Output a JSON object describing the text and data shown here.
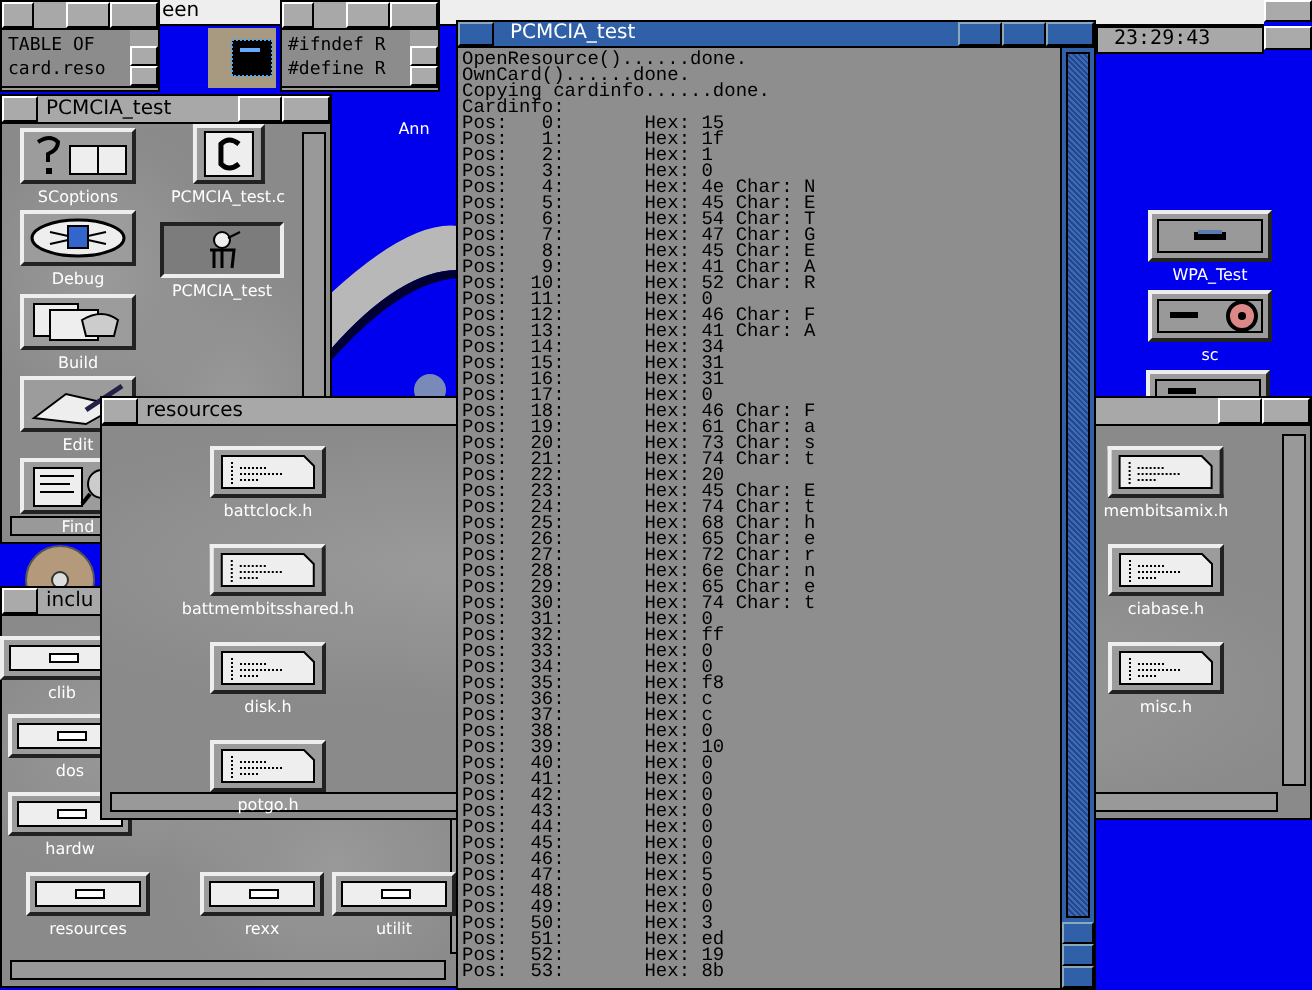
{
  "screen_bar": {
    "title": "een"
  },
  "clock": {
    "time": "23:29:43"
  },
  "text_windows": [
    {
      "lines": [
        "TABLE OF",
        "card.reso"
      ]
    },
    {
      "lines": [
        "#ifndef R",
        "#define R"
      ]
    }
  ],
  "desktop_icons": [
    {
      "label": "Ann",
      "kind": "covered"
    },
    {
      "label": "WPA_Test",
      "kind": "drawer"
    },
    {
      "label": "sc",
      "kind": "disk"
    }
  ],
  "drawers": [
    {
      "title": "PCMCIA_test",
      "icons": [
        {
          "label": "SCoptions",
          "kind": "options",
          "selected": false
        },
        {
          "label": "PCMCIA_test.c",
          "kind": "csource",
          "selected": false
        },
        {
          "label": "Debug",
          "kind": "debug",
          "selected": false
        },
        {
          "label": "PCMCIA_test",
          "kind": "program",
          "selected": true
        },
        {
          "label": "Build",
          "kind": "build",
          "selected": false
        },
        {
          "label": "Edit",
          "kind": "edit",
          "selected": false
        },
        {
          "label": "Find",
          "kind": "find",
          "selected": false
        }
      ]
    },
    {
      "title": "inclu",
      "icons": [
        {
          "label": "clib",
          "kind": "drawer",
          "selected": false
        },
        {
          "label": "dos",
          "kind": "drawer",
          "selected": false
        },
        {
          "label": "hardw",
          "kind": "drawer",
          "selected": false
        },
        {
          "label": "resources",
          "kind": "drawer",
          "selected": false
        },
        {
          "label": "rexx",
          "kind": "drawer",
          "selected": false
        },
        {
          "label": "utilit",
          "kind": "drawer",
          "selected": false
        }
      ]
    },
    {
      "title": "resources",
      "icons": [
        {
          "label": "battclock.h",
          "kind": "header",
          "selected": false
        },
        {
          "label": "battmembitsshared.h",
          "kind": "header",
          "selected": false
        },
        {
          "label": "disk.h",
          "kind": "header",
          "selected": false
        },
        {
          "label": "potgo.h",
          "kind": "header",
          "selected": false
        },
        {
          "label": "membitsamix.h",
          "kind": "header",
          "selected": false
        },
        {
          "label": "ciabase.h",
          "kind": "header",
          "selected": false
        },
        {
          "label": "misc.h",
          "kind": "header",
          "selected": false
        }
      ]
    }
  ],
  "console": {
    "title": "PCMCIA_test",
    "lines": [
      "OpenResource()......done.",
      "OwnCard()......done.",
      "Copying cardinfo......done.",
      "Cardinfo:",
      "Pos:   0:       Hex: 15",
      "Pos:   1:       Hex: 1f",
      "Pos:   2:       Hex: 1",
      "Pos:   3:       Hex: 0",
      "Pos:   4:       Hex: 4e Char: N",
      "Pos:   5:       Hex: 45 Char: E",
      "Pos:   6:       Hex: 54 Char: T",
      "Pos:   7:       Hex: 47 Char: G",
      "Pos:   8:       Hex: 45 Char: E",
      "Pos:   9:       Hex: 41 Char: A",
      "Pos:  10:       Hex: 52 Char: R",
      "Pos:  11:       Hex: 0",
      "Pos:  12:       Hex: 46 Char: F",
      "Pos:  13:       Hex: 41 Char: A",
      "Pos:  14:       Hex: 34",
      "Pos:  15:       Hex: 31",
      "Pos:  16:       Hex: 31",
      "Pos:  17:       Hex: 0",
      "Pos:  18:       Hex: 46 Char: F",
      "Pos:  19:       Hex: 61 Char: a",
      "Pos:  20:       Hex: 73 Char: s",
      "Pos:  21:       Hex: 74 Char: t",
      "Pos:  22:       Hex: 20",
      "Pos:  23:       Hex: 45 Char: E",
      "Pos:  24:       Hex: 74 Char: t",
      "Pos:  25:       Hex: 68 Char: h",
      "Pos:  26:       Hex: 65 Char: e",
      "Pos:  27:       Hex: 72 Char: r",
      "Pos:  28:       Hex: 6e Char: n",
      "Pos:  29:       Hex: 65 Char: e",
      "Pos:  30:       Hex: 74 Char: t",
      "Pos:  31:       Hex: 0",
      "Pos:  32:       Hex: ff",
      "Pos:  33:       Hex: 0",
      "Pos:  34:       Hex: 0",
      "Pos:  35:       Hex: f8",
      "Pos:  36:       Hex: c",
      "Pos:  37:       Hex: c",
      "Pos:  38:       Hex: 0",
      "Pos:  39:       Hex: 10",
      "Pos:  40:       Hex: 0",
      "Pos:  41:       Hex: 0",
      "Pos:  42:       Hex: 0",
      "Pos:  43:       Hex: 0",
      "Pos:  44:       Hex: 0",
      "Pos:  45:       Hex: 0",
      "Pos:  46:       Hex: 0",
      "Pos:  47:       Hex: 5",
      "Pos:  48:       Hex: 0",
      "Pos:  49:       Hex: 0",
      "Pos:  50:       Hex: 3",
      "Pos:  51:       Hex: ed",
      "Pos:  52:       Hex: 19",
      "Pos:  53:       Hex: 8b"
    ]
  }
}
